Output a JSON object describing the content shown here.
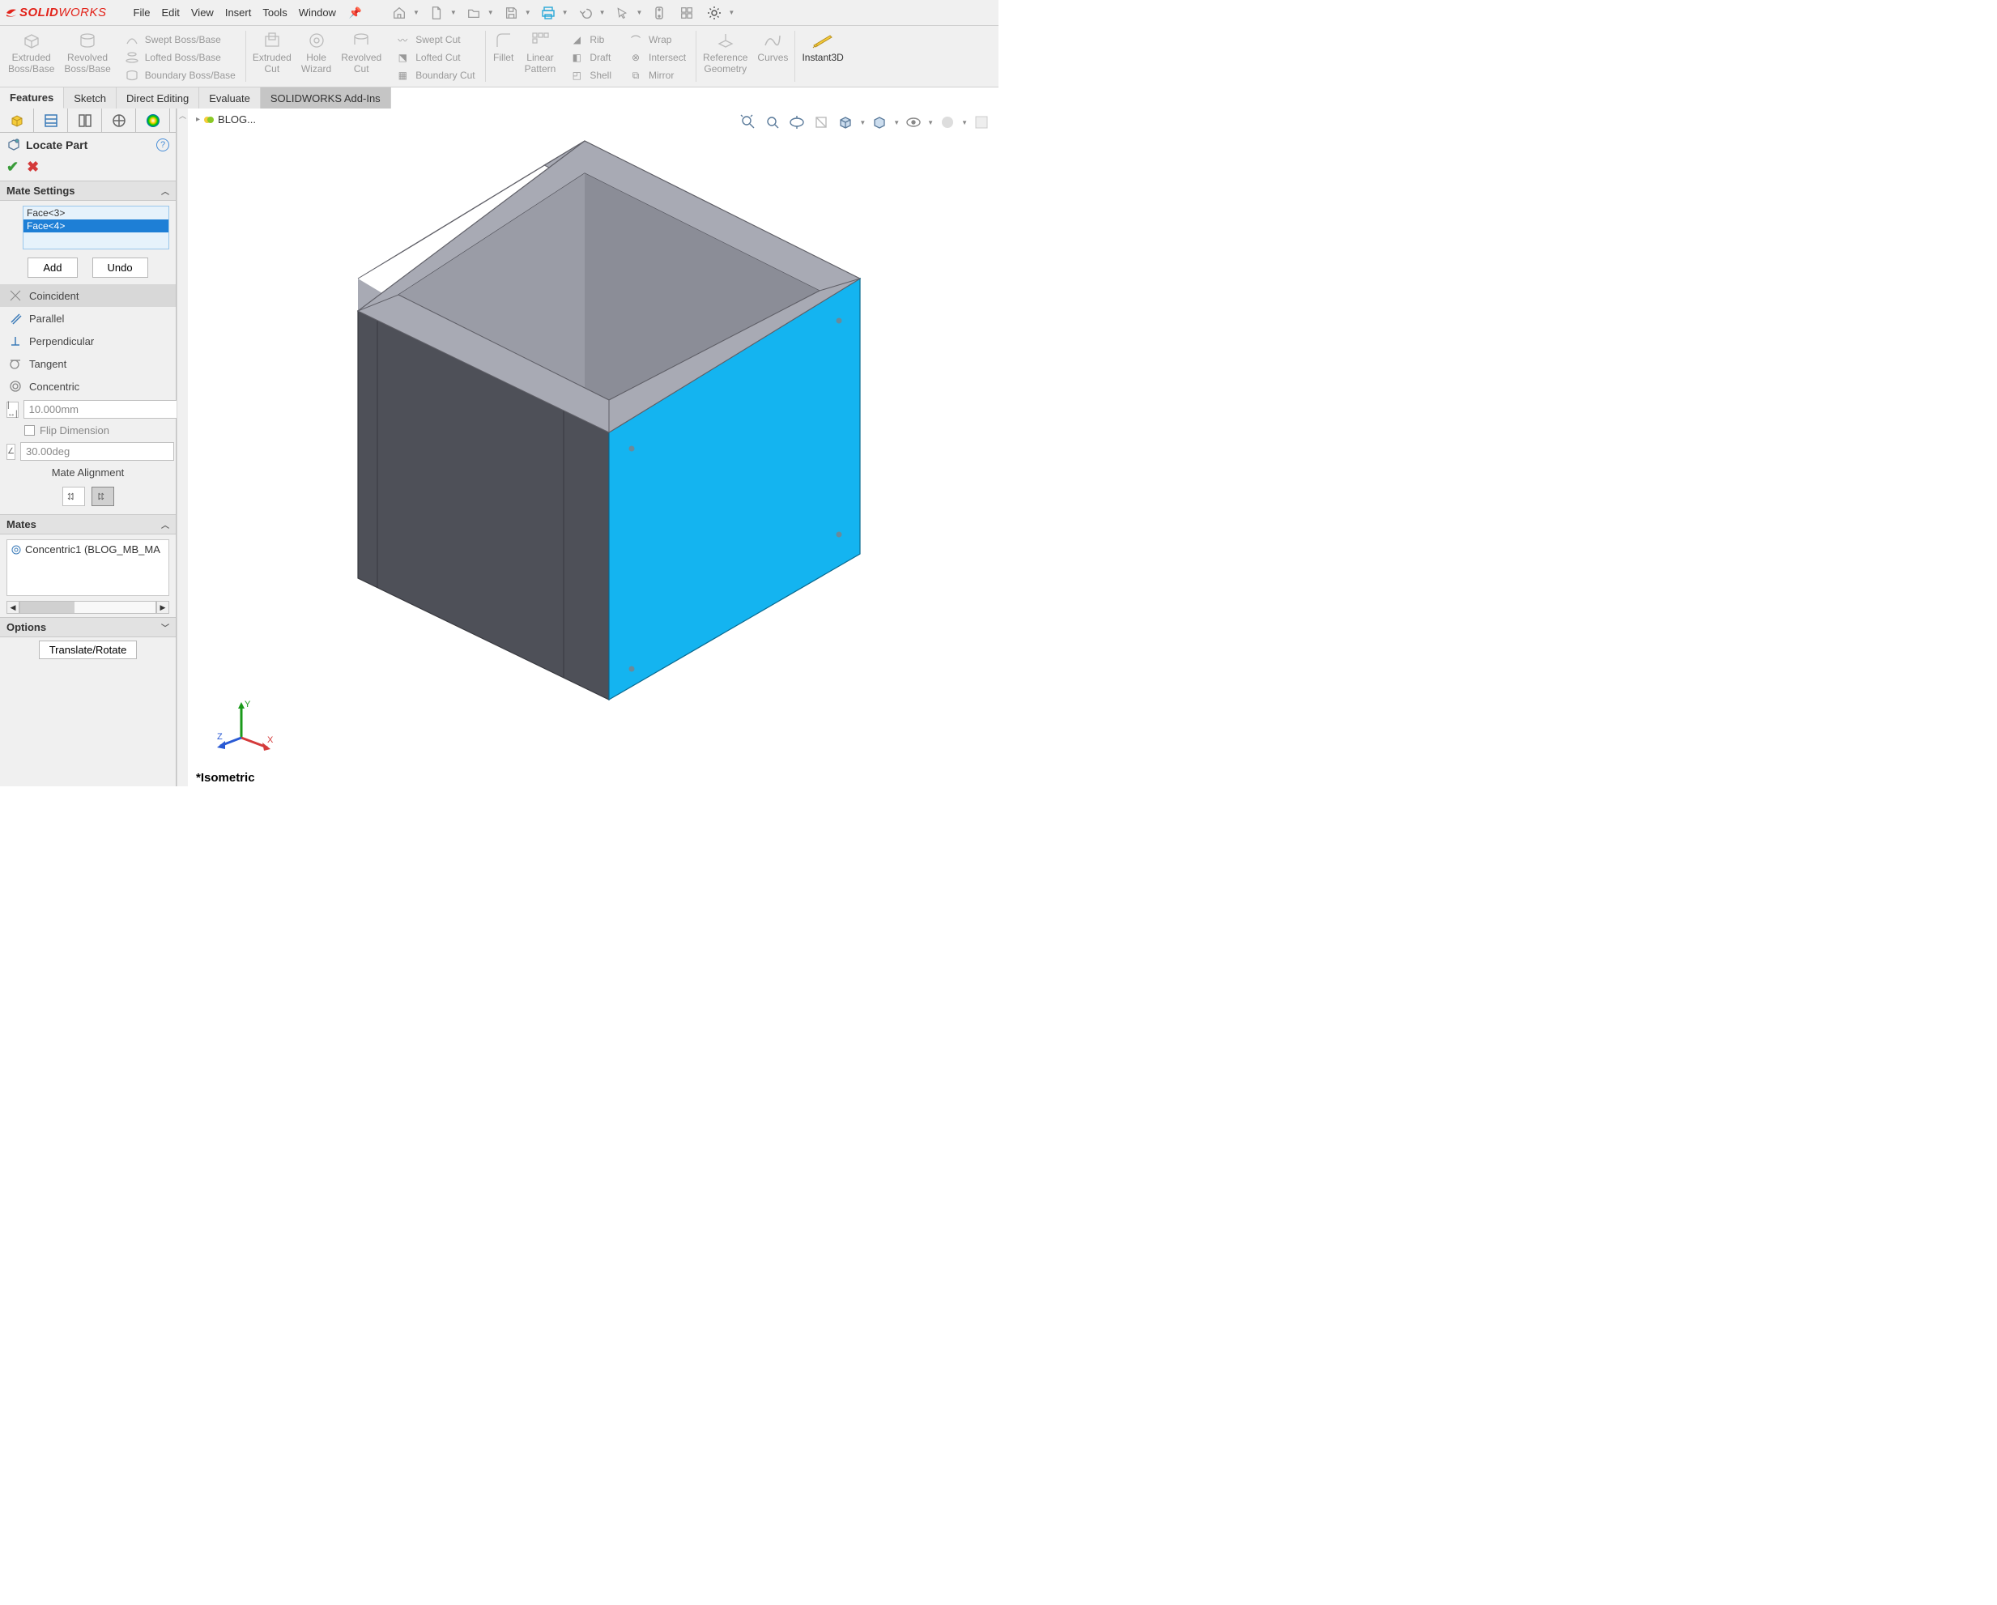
{
  "app": {
    "brand_ds": "DS ",
    "brand_solid": "SOLID",
    "brand_works": "WORKS"
  },
  "menu": {
    "file": "File",
    "edit": "Edit",
    "view": "View",
    "insert": "Insert",
    "tools": "Tools",
    "window": "Window"
  },
  "ribbon": {
    "extruded_boss": "Extruded\nBoss/Base",
    "revolved_boss": "Revolved\nBoss/Base",
    "swept_boss": "Swept Boss/Base",
    "lofted_boss": "Lofted Boss/Base",
    "boundary_boss": "Boundary Boss/Base",
    "extruded_cut": "Extruded\nCut",
    "hole_wizard": "Hole\nWizard",
    "revolved_cut": "Revolved\nCut",
    "swept_cut": "Swept Cut",
    "lofted_cut": "Lofted Cut",
    "boundary_cut": "Boundary Cut",
    "fillet": "Fillet",
    "linear_pattern": "Linear\nPattern",
    "rib": "Rib",
    "draft": "Draft",
    "shell": "Shell",
    "wrap": "Wrap",
    "intersect": "Intersect",
    "mirror": "Mirror",
    "ref_geom": "Reference\nGeometry",
    "curves": "Curves",
    "instant3d": "Instant3D"
  },
  "tabs": {
    "features": "Features",
    "sketch": "Sketch",
    "direct": "Direct Editing",
    "evaluate": "Evaluate",
    "addins": "SOLIDWORKS Add-Ins"
  },
  "breadcrumb": {
    "doc": "BLOG..."
  },
  "panel": {
    "title": "Locate Part",
    "mate_settings": "Mate Settings",
    "faces": [
      "Face<3>",
      "Face<4>"
    ],
    "add": "Add",
    "undo": "Undo",
    "coincident": "Coincident",
    "parallel": "Parallel",
    "perpendicular": "Perpendicular",
    "tangent": "Tangent",
    "concentric": "Concentric",
    "distance": "10.000mm",
    "flip": "Flip Dimension",
    "angle": "30.00deg",
    "align_label": "Mate Alignment",
    "mates_header": "Mates",
    "mate1": "Concentric1 (BLOG_MB_MA",
    "options": "Options",
    "translate": "Translate/Rotate"
  },
  "viewport": {
    "orientation": "*Isometric",
    "axes": {
      "x": "X",
      "y": "Y",
      "z": "Z"
    }
  }
}
